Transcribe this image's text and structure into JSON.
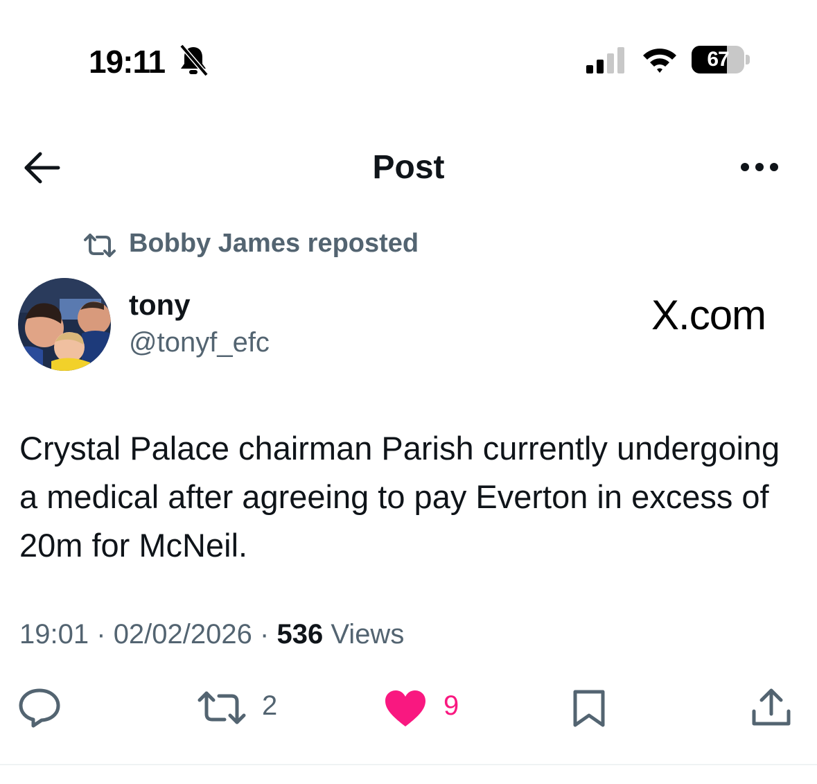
{
  "status_bar": {
    "time": "19:11",
    "battery_percent": "67",
    "battery_level": 0.67
  },
  "header": {
    "title": "Post"
  },
  "repost": {
    "text": "Bobby James reposted"
  },
  "author": {
    "name": "tony",
    "handle": "@tonyf_efc"
  },
  "brand": {
    "watermark": "X.com"
  },
  "post": {
    "text": "Crystal Palace chairman Parish currently undergoing a medical after agreeing to pay Everton in excess of 20m for McNeil."
  },
  "meta": {
    "time": "19:01",
    "date": "02/02/2026",
    "views_count": "536",
    "views_label": "Views",
    "separator": "·"
  },
  "actions": {
    "reposts": "2",
    "likes": "9"
  },
  "colors": {
    "text_primary": "#0f1419",
    "text_secondary": "#536471",
    "like_pink": "#f91880",
    "divider": "#eff3f4"
  },
  "icons": {
    "back": "arrow-left-icon",
    "more": "more-dots-icon",
    "repost": "repost-icon",
    "reply": "reply-icon",
    "like": "heart-icon",
    "bookmark": "bookmark-icon",
    "share": "share-icon",
    "mute": "bell-slash-icon",
    "signal": "cellular-signal-icon",
    "wifi": "wifi-icon",
    "battery": "battery-icon"
  }
}
